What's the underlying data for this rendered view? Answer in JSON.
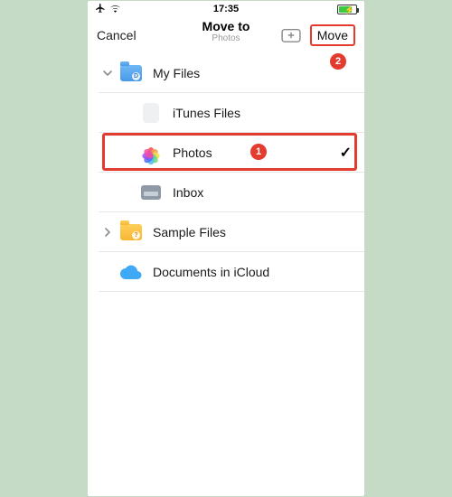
{
  "status": {
    "time": "17:35"
  },
  "nav": {
    "cancel": "Cancel",
    "title": "Move to",
    "subtitle": "Photos",
    "move": "Move"
  },
  "rows": {
    "myfiles": "My Files",
    "itunes": "iTunes Files",
    "photos": "Photos",
    "inbox": "Inbox",
    "sample": "Sample Files",
    "icloud": "Documents in iCloud"
  },
  "callouts": {
    "one": "1",
    "two": "2"
  },
  "colors": {
    "highlight": "#e33b2e",
    "background": "#c5dbc6"
  },
  "selected_row": "photos"
}
